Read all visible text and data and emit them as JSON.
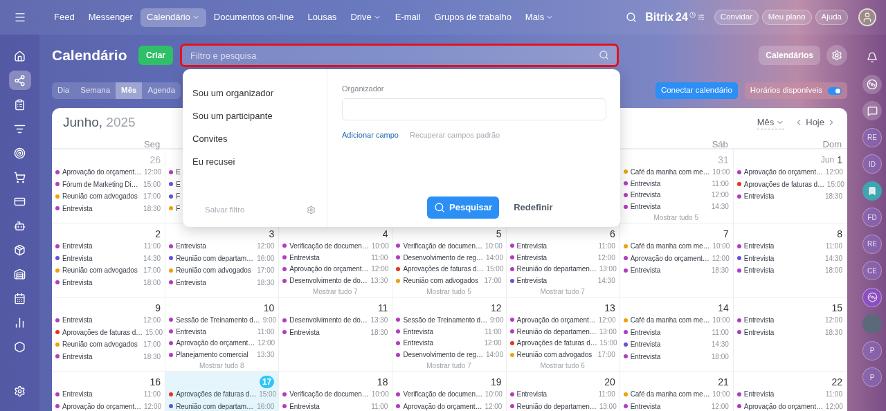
{
  "nav": {
    "items": [
      {
        "label": "Feed",
        "selected": false,
        "dropdown": false
      },
      {
        "label": "Messenger",
        "selected": false,
        "dropdown": false
      },
      {
        "label": "Calendário",
        "selected": true,
        "dropdown": true
      },
      {
        "label": "Documentos on-line",
        "selected": false,
        "dropdown": false
      },
      {
        "label": "Lousas",
        "selected": false,
        "dropdown": false
      },
      {
        "label": "Drive",
        "selected": false,
        "dropdown": true
      },
      {
        "label": "E-mail",
        "selected": false,
        "dropdown": false
      },
      {
        "label": "Grupos de trabalho",
        "selected": false,
        "dropdown": false
      },
      {
        "label": "Mais",
        "selected": false,
        "dropdown": true
      }
    ],
    "logo": "Bitrix",
    "logo_number": "24",
    "buttons": [
      "Convidar",
      "Meu plano",
      "Ajuda"
    ]
  },
  "sidebar": [
    {
      "kind": "home",
      "selected": false
    },
    {
      "kind": "sync",
      "selected": true
    },
    {
      "kind": "tasks",
      "selected": false
    },
    {
      "kind": "funnel",
      "selected": false
    },
    {
      "kind": "target",
      "selected": false
    },
    {
      "kind": "cart",
      "selected": false
    },
    {
      "kind": "card",
      "selected": false
    },
    {
      "kind": "robot",
      "selected": false
    },
    {
      "kind": "package",
      "selected": false
    },
    {
      "kind": "store",
      "selected": false
    },
    {
      "kind": "calendar",
      "selected": false
    },
    {
      "kind": "chart",
      "selected": false
    },
    {
      "kind": "hexagon",
      "selected": false
    }
  ],
  "header": {
    "title": "Calendário",
    "create": "Criar",
    "search_placeholder": "Filtro e pesquisa",
    "calendars": "Calendários"
  },
  "views": [
    {
      "label": "Dia",
      "selected": false
    },
    {
      "label": "Semana",
      "selected": false
    },
    {
      "label": "Mês",
      "selected": true
    },
    {
      "label": "Agenda",
      "selected": false
    }
  ],
  "connect": "Conectar calendário",
  "availability": {
    "label": "Horários disponíveis",
    "on": true
  },
  "calendar": {
    "month": "Junho,",
    "year": "2025",
    "view_select": "Mês",
    "today": "Hoje",
    "weekdays": {
      "left": [
        "Seg"
      ],
      "right": [
        "Sáb",
        "Dom"
      ]
    },
    "weeks": [
      {
        "left": [
          {
            "day": "26",
            "other_month": true,
            "today": false,
            "events": [
              {
                "title": "Aprovação do orçament…",
                "time": "12:00",
                "color": "#b23cc0"
              },
              {
                "title": "Fórum de Marketing Di…",
                "time": "15:00",
                "color": "#b23cc0"
              },
              {
                "title": "Reunião com advogados",
                "time": "17:00",
                "color": "#f0a00a"
              },
              {
                "title": "Entrevista",
                "time": "18:30",
                "color": "#b23cc0"
              }
            ]
          },
          {
            "events": [
              {
                "title": "E",
                "color": "#b23cc0"
              },
              {
                "title": "E",
                "color": "#6652d8"
              },
              {
                "title": "F",
                "color": "#6652d8"
              },
              {
                "title": "F",
                "color": "#f0a00a"
              }
            ]
          }
        ],
        "right": [
          {
            "day": "31",
            "other_month": true,
            "today": false,
            "events": [
              {
                "title": "Café da manha com me…",
                "time": "10:00",
                "color": "#f0a00a"
              },
              {
                "title": "Entrevista",
                "time": "11:00",
                "color": "#b23cc0"
              },
              {
                "title": "Entrevista",
                "time": "12:00",
                "color": "#b23cc0"
              },
              {
                "title": "Entrevista",
                "time": "14:30",
                "color": "#b23cc0"
              }
            ],
            "more": "Mostrar tudo 5"
          },
          {
            "month_prefix": "Jun",
            "day": "1",
            "other_month": false,
            "today": false,
            "events": [
              {
                "title": "Aprovação do orçament…",
                "time": "12:00",
                "color": "#b23cc0"
              },
              {
                "title": "Aprovações de faturas d…",
                "time": "15:00",
                "color": "#e8321f"
              },
              {
                "title": "Entrevista",
                "time": "18:30",
                "color": "#b23cc0"
              }
            ]
          }
        ]
      },
      {
        "days": [
          {
            "day": "2",
            "other_month": false,
            "today": false,
            "events": [
              {
                "title": "Entrevista",
                "time": "11:00",
                "color": "#b23cc0"
              },
              {
                "title": "Entrevista",
                "time": "14:30",
                "color": "#6652d8"
              },
              {
                "title": "Reunião com advogados",
                "time": "17:00",
                "color": "#f0a00a"
              },
              {
                "title": "Entrevista",
                "time": "18:00",
                "color": "#b23cc0"
              }
            ]
          },
          {
            "day": "3",
            "other_month": false,
            "today": false,
            "events": [
              {
                "title": "Entrevista",
                "time": "12:00",
                "color": "#b23cc0"
              },
              {
                "title": "Reunião com departam…",
                "time": "16:00",
                "color": "#6652d8"
              },
              {
                "title": "Reunião com advogados",
                "time": "17:00",
                "color": "#f0a00a"
              },
              {
                "title": "Entrevista",
                "time": "18:30",
                "color": "#b23cc0"
              }
            ]
          },
          {
            "day": "4",
            "other_month": false,
            "today": false,
            "events": [
              {
                "title": "Verificação de documen…",
                "time": "10:00",
                "color": "#b23cc0"
              },
              {
                "title": "Entrevista",
                "time": "11:00",
                "color": "#b23cc0"
              },
              {
                "title": "Aprovação do orçament…",
                "time": "12:00",
                "color": "#b23cc0"
              },
              {
                "title": "Desenvolvimento de do…",
                "time": "13:30",
                "color": "#b23cc0"
              }
            ],
            "more": "Mostrar tudo 7"
          },
          {
            "day": "5",
            "other_month": false,
            "today": false,
            "events": [
              {
                "title": "Verificação de documen…",
                "time": "10:00",
                "color": "#b23cc0"
              },
              {
                "title": "Desenvolvimento de reg…",
                "time": "14:00",
                "color": "#b23cc0"
              },
              {
                "title": "Aprovações de faturas d…",
                "time": "15:00",
                "color": "#e8321f"
              },
              {
                "title": "Reunião com advogados",
                "time": "17:00",
                "color": "#f0a00a"
              }
            ],
            "more": "Mostrar tudo 5"
          },
          {
            "day": "6",
            "other_month": false,
            "today": false,
            "events": [
              {
                "title": "Entrevista",
                "time": "11:00",
                "color": "#b23cc0"
              },
              {
                "title": "Entrevista",
                "time": "12:00",
                "color": "#b23cc0"
              },
              {
                "title": "Reunião do departamen…",
                "time": "13:00",
                "color": "#b23cc0"
              },
              {
                "title": "Entrevista",
                "time": "14:30",
                "color": "#6652d8"
              }
            ],
            "more": "Mostrar tudo 7"
          },
          {
            "day": "7",
            "other_month": false,
            "today": false,
            "events": [
              {
                "title": "Café da manha com me…",
                "time": "10:00",
                "color": "#f0a00a"
              },
              {
                "title": "Aprovação do orçament…",
                "time": "12:00",
                "color": "#b23cc0"
              },
              {
                "title": "Entrevista",
                "time": "18:30",
                "color": "#b23cc0"
              }
            ]
          },
          {
            "day": "8",
            "other_month": false,
            "today": false,
            "events": [
              {
                "title": "Entrevista",
                "time": "11:00",
                "color": "#b23cc0"
              },
              {
                "title": "Entrevista",
                "time": "14:30",
                "color": "#6652d8"
              },
              {
                "title": "Entrevista",
                "time": "18:00",
                "color": "#b23cc0"
              }
            ]
          }
        ]
      },
      {
        "days": [
          {
            "day": "9",
            "other_month": false,
            "today": false,
            "events": [
              {
                "title": "Entrevista",
                "time": "12:00",
                "color": "#b23cc0"
              },
              {
                "title": "Aprovações de faturas d…",
                "time": "15:00",
                "color": "#e8321f"
              },
              {
                "title": "Reunião com advogados",
                "time": "17:00",
                "color": "#f0a00a"
              },
              {
                "title": "Entrevista",
                "time": "18:30",
                "color": "#b23cc0"
              }
            ]
          },
          {
            "day": "10",
            "other_month": false,
            "today": false,
            "events": [
              {
                "title": "Sessão de Treinamento d…",
                "time": "9:00",
                "color": "#b23cc0"
              },
              {
                "title": "Entrevista",
                "time": "11:00",
                "color": "#b23cc0"
              },
              {
                "title": "Aprovação do orçament…",
                "time": "12:00",
                "color": "#b23cc0"
              },
              {
                "title": "Planejamento comercial",
                "time": "13:30",
                "color": "#b23cc0"
              }
            ],
            "more": "Mostrar tudo 8"
          },
          {
            "day": "11",
            "other_month": false,
            "today": false,
            "events": [
              {
                "title": "Desenvolvimento de do…",
                "time": "13:30",
                "color": "#b23cc0"
              },
              {
                "title": "Entrevista",
                "time": "18:30",
                "color": "#b23cc0"
              }
            ]
          },
          {
            "day": "12",
            "other_month": false,
            "today": false,
            "events": [
              {
                "title": "Sessão de Treinamento d…",
                "time": "9:00",
                "color": "#b23cc0"
              },
              {
                "title": "Entrevista",
                "time": "11:00",
                "color": "#b23cc0"
              },
              {
                "title": "Entrevista",
                "time": "12:00",
                "color": "#b23cc0"
              },
              {
                "title": "Desenvolvimento de reg…",
                "time": "14:00",
                "color": "#b23cc0"
              }
            ],
            "more": "Mostrar tudo 7"
          },
          {
            "day": "13",
            "other_month": false,
            "today": false,
            "events": [
              {
                "title": "Aprovação do orçament…",
                "time": "12:00",
                "color": "#b23cc0"
              },
              {
                "title": "Reunião do departamen…",
                "time": "13:00",
                "color": "#b23cc0"
              },
              {
                "title": "Aprovações de faturas d…",
                "time": "15:00",
                "color": "#e8321f"
              },
              {
                "title": "Reunião com advogados",
                "time": "17:00",
                "color": "#f0a00a"
              }
            ],
            "more": "Mostrar tudo 6"
          },
          {
            "day": "14",
            "other_month": false,
            "today": false,
            "events": [
              {
                "title": "Café da manha com me…",
                "time": "10:00",
                "color": "#f0a00a"
              },
              {
                "title": "Entrevista",
                "time": "11:00",
                "color": "#b23cc0"
              },
              {
                "title": "Entrevista",
                "time": "14:30",
                "color": "#6652d8"
              },
              {
                "title": "Entrevista",
                "time": "18:00",
                "color": "#b23cc0"
              }
            ]
          },
          {
            "day": "15",
            "other_month": false,
            "today": false,
            "events": [
              {
                "title": "Entrevista",
                "time": "12:00",
                "color": "#b23cc0"
              },
              {
                "title": "Entrevista",
                "time": "18:30",
                "color": "#b23cc0"
              }
            ]
          }
        ]
      },
      {
        "days": [
          {
            "day": "16",
            "other_month": false,
            "today": false,
            "events": [
              {
                "title": "Entrevista",
                "time": "11:00",
                "color": "#b23cc0"
              },
              {
                "title": "Aprovação do orçament…",
                "time": "12:00",
                "color": "#b23cc0"
              }
            ]
          },
          {
            "day": "17",
            "other_month": false,
            "today": true,
            "events": [
              {
                "title": "Aprovações de faturas d…",
                "time": "15:00",
                "color": "#e8321f"
              },
              {
                "title": "Reunião com departam…",
                "time": "16:00",
                "color": "#6652d8"
              }
            ]
          },
          {
            "day": "18",
            "other_month": false,
            "today": false,
            "events": [
              {
                "title": "Verificação de documen…",
                "time": "10:00",
                "color": "#b23cc0"
              },
              {
                "title": "Entrevista",
                "time": "11:00",
                "color": "#b23cc0"
              }
            ]
          },
          {
            "day": "19",
            "other_month": false,
            "today": false,
            "events": [
              {
                "title": "Verificação de documen…",
                "time": "10:00",
                "color": "#b23cc0"
              },
              {
                "title": "Aprovação do orçament…",
                "time": "12:00",
                "color": "#b23cc0"
              }
            ]
          },
          {
            "day": "20",
            "other_month": false,
            "today": false,
            "events": [
              {
                "title": "Entrevista",
                "time": "11:00",
                "color": "#b23cc0"
              },
              {
                "title": "Reunião do departamen…",
                "time": "13:00",
                "color": "#b23cc0"
              }
            ]
          },
          {
            "day": "21",
            "other_month": false,
            "today": false,
            "events": [
              {
                "title": "Café da manha com me…",
                "time": "10:00",
                "color": "#f0a00a"
              },
              {
                "title": "Entrevista",
                "time": "12:00",
                "color": "#b23cc0"
              }
            ]
          },
          {
            "day": "22",
            "other_month": false,
            "today": false,
            "events": [
              {
                "title": "Entrevista",
                "time": "11:00",
                "color": "#b23cc0"
              },
              {
                "title": "Aprovação do orçament…",
                "time": "12:00",
                "color": "#b23cc0"
              }
            ]
          }
        ]
      }
    ]
  },
  "filter_popup": {
    "presets": [
      "Sou um organizador",
      "Sou um participante",
      "Convites",
      "Eu recusei"
    ],
    "save": "Salvar filtro",
    "field_label": "Organizador",
    "add_field": "Adicionar campo",
    "restore": "Recuperar campos padrão",
    "search": "Pesquisar",
    "reset": "Redefinir"
  },
  "right_rail": [
    {
      "kind": "bell"
    },
    {
      "kind": "swirl"
    },
    {
      "kind": "chat"
    },
    {
      "kind": "avatar",
      "initials": "RE"
    },
    {
      "kind": "avatar",
      "initials": "ID"
    },
    {
      "kind": "bookmark"
    },
    {
      "kind": "avatar",
      "initials": "FD"
    },
    {
      "kind": "avatar",
      "initials": "RE"
    },
    {
      "kind": "avatar",
      "initials": "CE"
    },
    {
      "kind": "swirl_avatar"
    },
    {
      "kind": "photo"
    },
    {
      "kind": "avatar",
      "initials": "P"
    },
    {
      "kind": "avatar",
      "initials": "P"
    }
  ]
}
